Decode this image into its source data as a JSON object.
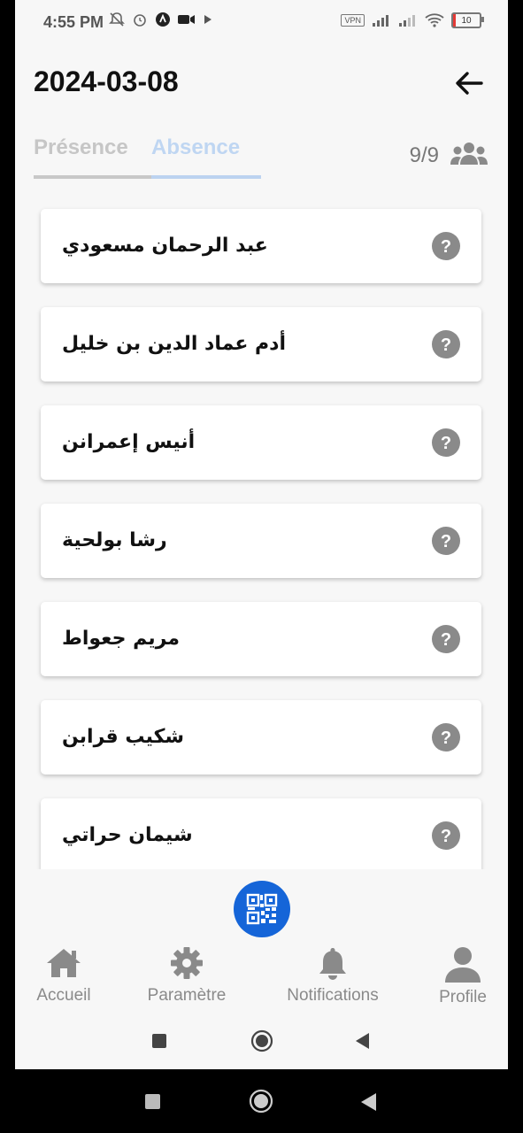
{
  "status_bar": {
    "time": "4:55 PM",
    "vpn": "VPN",
    "battery": "10"
  },
  "header": {
    "date": "2024-03-08",
    "back_icon": "arrow-left-icon"
  },
  "tabs": {
    "presence": "Présence",
    "absence": "Absence"
  },
  "count": "9/9",
  "students": [
    {
      "name": "عبد الرحمان  مسعودي"
    },
    {
      "name": "أدم عماد الدين   بن خليل"
    },
    {
      "name": "أنيس  إعمرانن"
    },
    {
      "name": "رشا  بولحية"
    },
    {
      "name": "مريم  جعواط"
    },
    {
      "name": "شكيب  قرابن"
    },
    {
      "name": "شيمان  حراتي"
    }
  ],
  "bottom_nav": [
    {
      "label": "Accueil",
      "icon": "home-icon"
    },
    {
      "label": "Paramètre",
      "icon": "gear-icon"
    },
    {
      "label": "Notifications",
      "icon": "bell-icon"
    },
    {
      "label": "Profile",
      "icon": "user-icon"
    }
  ],
  "colors": {
    "accent": "#1565d8",
    "background": "#f7f7f7"
  }
}
